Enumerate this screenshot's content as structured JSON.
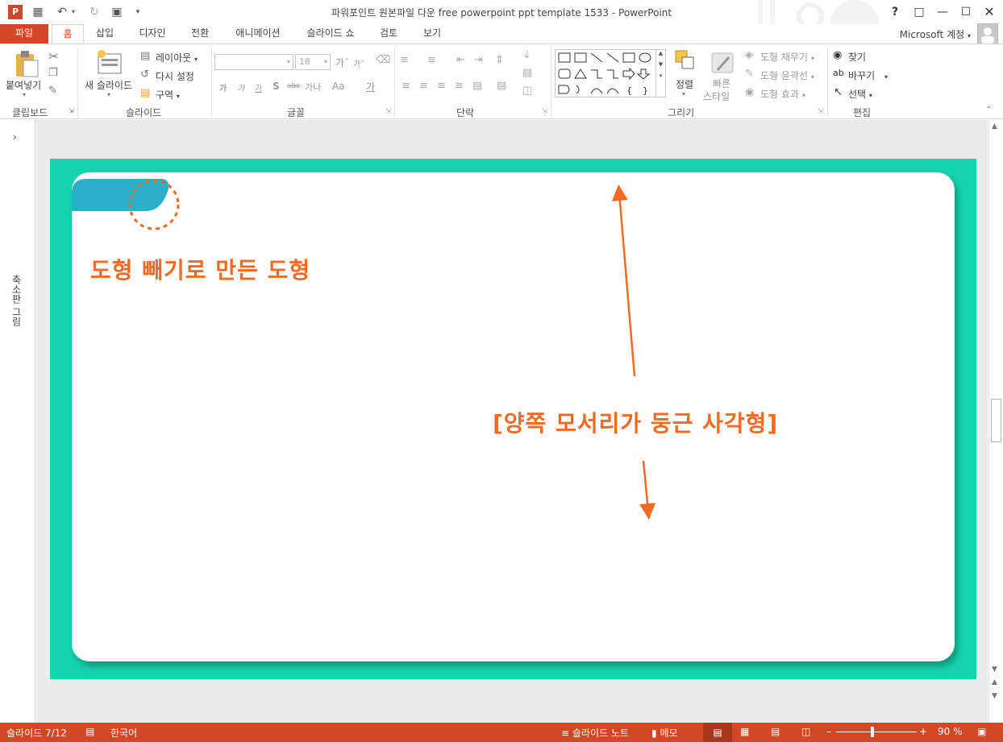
{
  "window": {
    "title": "파워포인트 원본파일 다운 free powerpoint ppt template 1533 - PowerPoint",
    "controls": [
      "?",
      "restore",
      "minimize",
      "maximize",
      "close"
    ]
  },
  "qat": [
    "powerpoint-logo",
    "save",
    "undo",
    "redo",
    "start-from-beginning",
    "customize"
  ],
  "tabs": [
    {
      "label": "파일"
    },
    {
      "label": "홈"
    },
    {
      "label": "삽입"
    },
    {
      "label": "디자인"
    },
    {
      "label": "전환"
    },
    {
      "label": "애니메이션"
    },
    {
      "label": "슬라이드 쇼"
    },
    {
      "label": "검토"
    },
    {
      "label": "보기"
    }
  ],
  "account": "Microsoft 계정",
  "ribbon": {
    "clipboard": {
      "paste": "붙여넣기",
      "label": "클립보드"
    },
    "slides": {
      "new_slide": "새 슬라이드",
      "layout": "레이아웃",
      "reset": "다시 설정",
      "section": "구역",
      "label": "슬라이드"
    },
    "font": {
      "size": "18",
      "label": "글꼴",
      "bold": "가",
      "italic": "가",
      "underline": "가",
      "shadow": "S",
      "strike": "abc",
      "spacing": "가나",
      "case": "Aa",
      "color": "가"
    },
    "paragraph": {
      "label": "단락"
    },
    "drawing": {
      "arrange": "정렬",
      "quick_styles_1": "빠른",
      "quick_styles_2": "스타일",
      "fill": "도형 채우기",
      "outline": "도형 윤곽선",
      "effects": "도형 효과",
      "label": "그리기"
    },
    "editing": {
      "find": "찾기",
      "replace": "바꾸기",
      "select": "선택",
      "label": "편집"
    }
  },
  "left_pane": {
    "label": "축소판 그림"
  },
  "slide": {
    "title": "도형 빼기로 만든 도형",
    "annotation": "[양쪽 모서리가 둥근 사각형]",
    "colors": {
      "background": "#17d2af",
      "card": "#ffffff",
      "accent": "#f36a23",
      "tab": "#2ab0c8"
    }
  },
  "statusbar": {
    "slide_info": "슬라이드 7/12",
    "language": "한국어",
    "notes": "슬라이드 노트",
    "comments": "메모",
    "zoom": "90 %"
  }
}
